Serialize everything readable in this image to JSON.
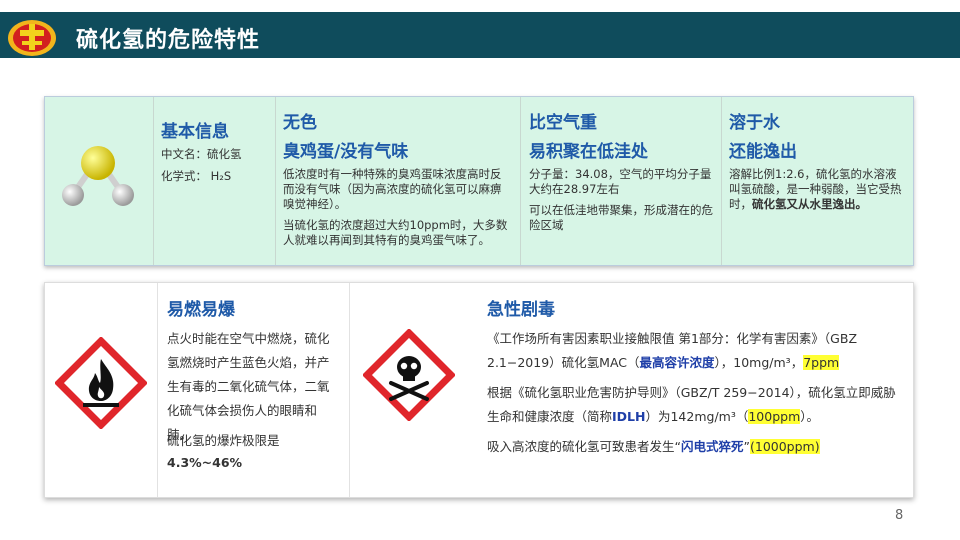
{
  "header": {
    "title": "硫化氢的危险特性"
  },
  "basic": {
    "title": "基本信息",
    "cn_name": "中文名：硫化氢",
    "formula": "化学式：  H₂S"
  },
  "colorless": {
    "title1": "无色",
    "title2": "臭鸡蛋/没有气味",
    "para1": "低浓度时有一种特殊的臭鸡蛋味浓度高时反而没有气味（因为高浓度的硫化氢可以麻痹嗅觉神经）。",
    "para2": "当硫化氢的浓度超过大约10ppm时，大多数人就难以再闻到其特有的臭鸡蛋气味了。"
  },
  "heavier": {
    "title1": "比空气重",
    "title2": "易积聚在低洼处",
    "para1": "分子量：34.08，空气的平均分子量大约在28.97左右",
    "para2": "可以在低洼地带聚集，形成潜在的危险区域"
  },
  "water": {
    "title1": "溶于水",
    "title2": "还能逸出",
    "para_a": "溶解比例1:2.6，硫化氢的水溶液叫氢硫酸，是一种弱酸，当它受热时，",
    "para_b": "硫化氢又从水里逸出。"
  },
  "flammable": {
    "title": "易燃易爆",
    "para1": "点火时能在空气中燃烧，硫化氢燃烧时产生蓝色火焰，并产生有毒的二氧化硫气体，二氧化硫气体会损伤人的眼睛和肺。",
    "para2": "硫化氢的爆炸极限是",
    "limit": "4.3%~46%"
  },
  "toxic": {
    "title": "急性剧毒",
    "p1_a": "《工作场所有害因素职业接触限值 第1部分：化学有害因素》（GBZ 2.1−2019）硫化氢MAC（",
    "p1_b": "最高容许浓度",
    "p1_c": "），10mg/m³，",
    "p1_d": "7ppm",
    "p2_a": "根据《硫化氢职业危害防护导则》（GBZ/T 259−2014），硫化氢立即威胁生命和健康浓度（简称",
    "p2_b": "IDLH",
    "p2_c": "）为142mg/m³（",
    "p2_d": "100ppm",
    "p2_e": "）。",
    "p3_a": "吸入高浓度的硫化氢可致患者发生“",
    "p3_b": "闪电式猝死",
    "p3_c": "”",
    "p3_d": "(1000ppm)"
  },
  "page_number": "8",
  "colors": {
    "header_bg": "#0f4c5c",
    "accent_blue": "#1f5aa8",
    "panel_green": "#d7f5e6",
    "highlight": "#ffff33",
    "hazard_red": "#e0262b"
  },
  "icons": {
    "logo": "emblem-icon",
    "molecule": "h2s-molecule-icon",
    "flame": "flammable-hazard-icon",
    "skull": "toxic-hazard-icon"
  }
}
